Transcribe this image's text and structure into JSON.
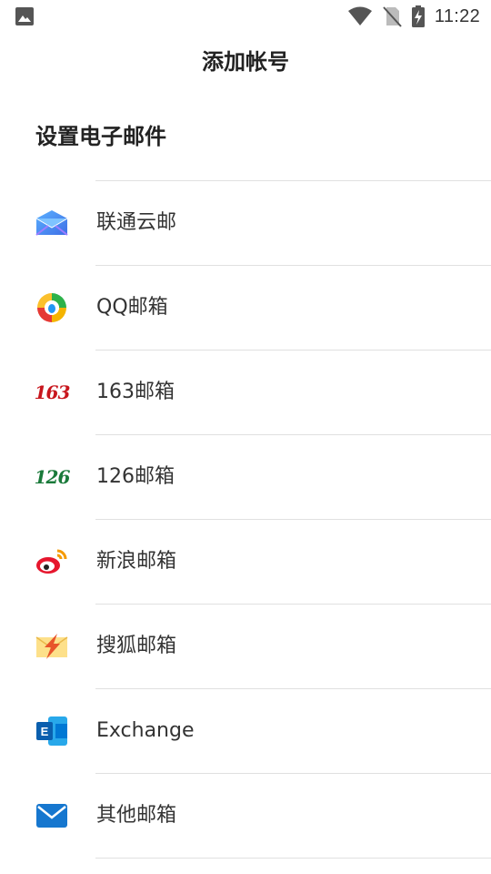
{
  "status_bar": {
    "time": "11:22"
  },
  "header": {
    "title": "添加帐号"
  },
  "section": {
    "title": "设置电子邮件"
  },
  "providers": [
    {
      "label": "联通云邮",
      "icon": "envelope-blue-icon"
    },
    {
      "label": "QQ邮箱",
      "icon": "qq-mail-icon"
    },
    {
      "label": "163邮箱",
      "icon": "netease-163-icon",
      "logo_text": "163",
      "logo_color": "#c8161d"
    },
    {
      "label": "126邮箱",
      "icon": "netease-126-icon",
      "logo_text": "126",
      "logo_color": "#1a7a3a"
    },
    {
      "label": "新浪邮箱",
      "icon": "sina-weibo-icon"
    },
    {
      "label": "搜狐邮箱",
      "icon": "sohu-mail-icon"
    },
    {
      "label": "Exchange",
      "icon": "exchange-icon"
    },
    {
      "label": "其他邮箱",
      "icon": "mail-envelope-icon"
    }
  ]
}
